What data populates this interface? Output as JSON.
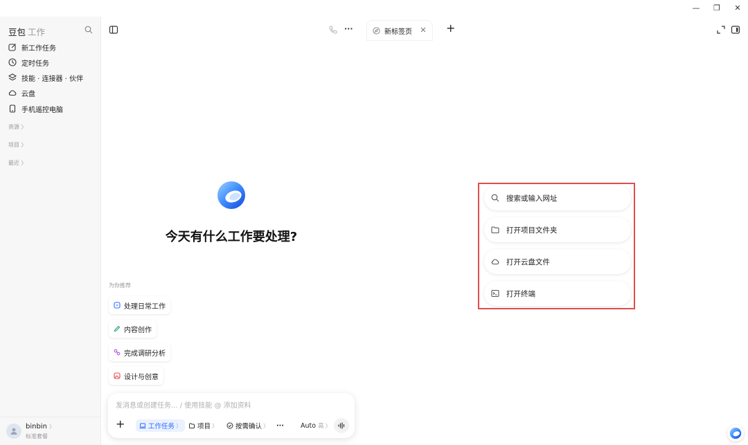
{
  "window": {
    "minimize_glyph": "—",
    "restore_glyph": "❐",
    "close_glyph": "✕"
  },
  "sidebar": {
    "brand_name": "豆包",
    "brand_sub": "工作",
    "items": [
      {
        "label": "新工作任务",
        "icon": "edit-icon"
      },
      {
        "label": "定时任务",
        "icon": "clock-icon"
      },
      {
        "label": "技能 · 连接器 · 伙伴",
        "icon": "layers-icon"
      },
      {
        "label": "云盘",
        "icon": "cloud-icon"
      },
      {
        "label": "手机遥控电脑",
        "icon": "phone-icon"
      }
    ],
    "sections": [
      {
        "label": "资源 〉"
      },
      {
        "label": "项目 〉"
      },
      {
        "label": "最近 〉"
      }
    ],
    "user": {
      "name": "binbin",
      "name_suffix": "〉",
      "plan": "标准套餐"
    }
  },
  "header": {
    "tab": {
      "label": "新标签页"
    },
    "more_glyph": "···",
    "add_glyph": "+"
  },
  "main": {
    "headline": "今天有什么工作要处理?",
    "recommend_title": "为你推荐",
    "recommendations": [
      {
        "label": "处理日常工作",
        "color": "#2f6bff"
      },
      {
        "label": "内容创作",
        "color": "#22a06b"
      },
      {
        "label": "完成调研分析",
        "color": "#b452e0"
      },
      {
        "label": "设计与创意",
        "color": "#e5484d"
      }
    ],
    "quick_actions": [
      {
        "label": "搜索或输入网址",
        "icon": "search-icon"
      },
      {
        "label": "打开项目文件夹",
        "icon": "folder-icon"
      },
      {
        "label": "打开云盘文件",
        "icon": "cloud-icon"
      },
      {
        "label": "打开终端",
        "icon": "terminal-icon"
      }
    ]
  },
  "composer": {
    "placeholder": "发消息或创建任务... / 使用技能 @ 添加资料",
    "add_glyph": "+",
    "tools": [
      {
        "label": "工作任务",
        "caret": "〉"
      },
      {
        "label": "项目",
        "caret": "〉"
      },
      {
        "label": "按需确认",
        "caret": "〉"
      }
    ],
    "more_glyph": "···",
    "model": {
      "label": "Auto",
      "level": "高",
      "caret": "〉"
    }
  },
  "colors": {
    "accent": "#2f6bff",
    "highlight_border": "#e34b4b",
    "sidebar_bg": "#f7f7f8"
  }
}
